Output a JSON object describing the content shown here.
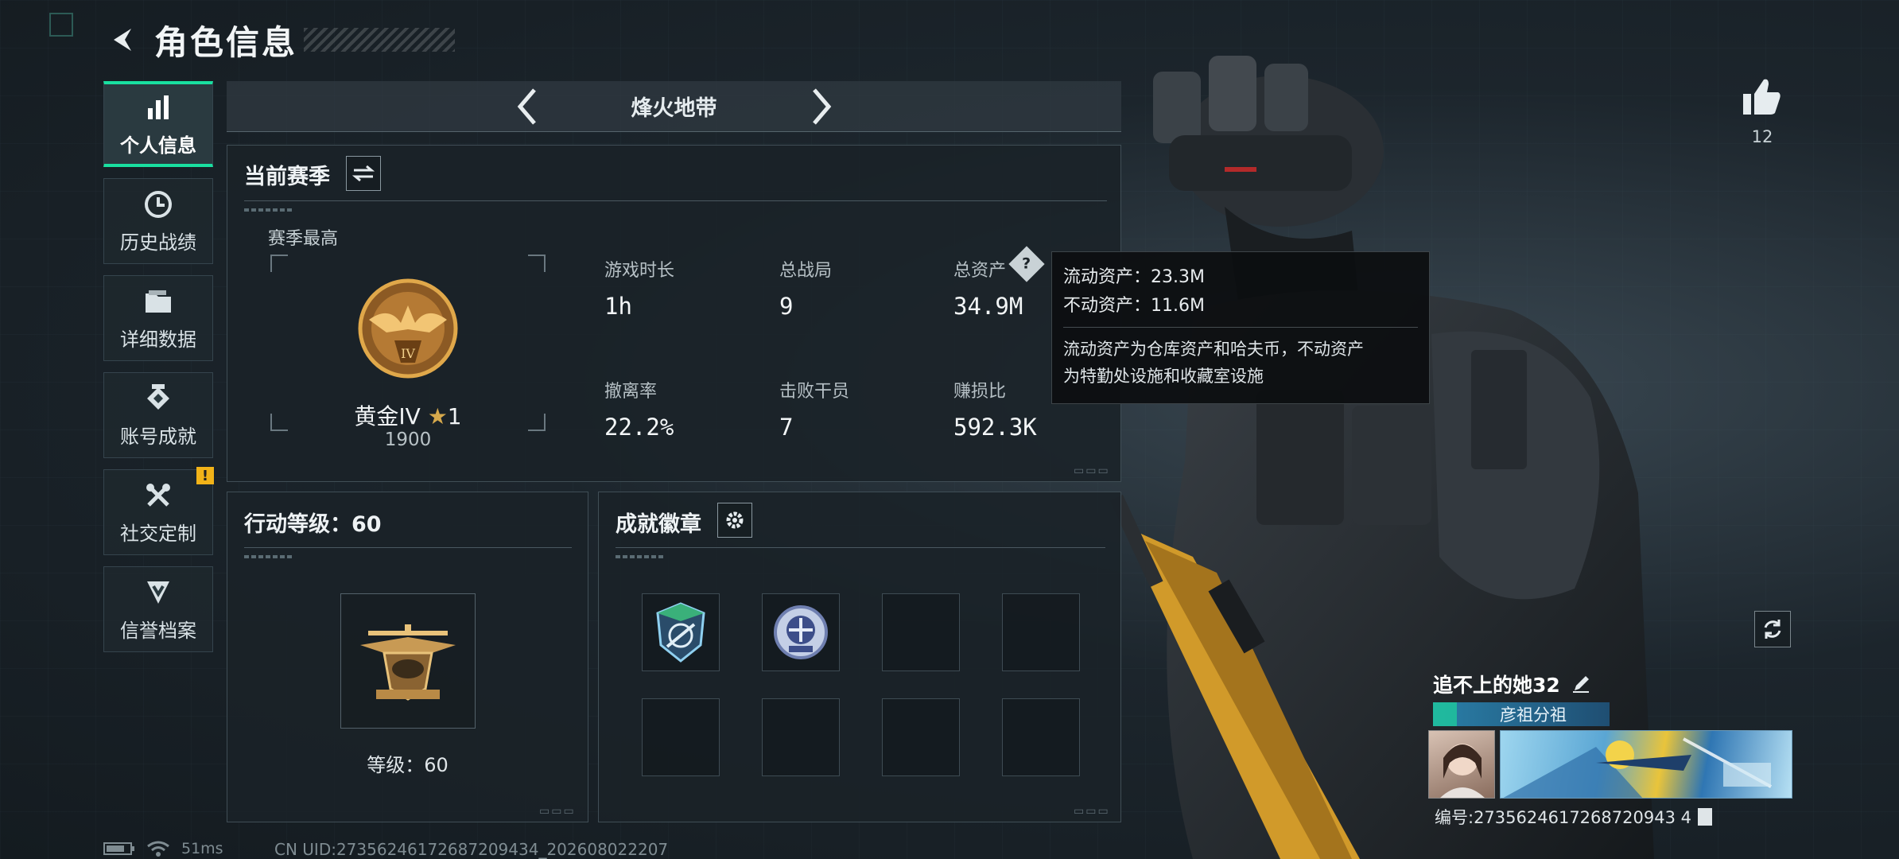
{
  "header": {
    "title": "角色信息"
  },
  "sidebar": {
    "items": [
      {
        "label": "个人信息",
        "icon": "bar-chart-icon",
        "active": true
      },
      {
        "label": "历史战绩",
        "icon": "history-clock-icon"
      },
      {
        "label": "详细数据",
        "icon": "folder-icon"
      },
      {
        "label": "账号成就",
        "icon": "achievement-emblem-icon"
      },
      {
        "label": "社交定制",
        "icon": "tools-icon",
        "badge": "!"
      },
      {
        "label": "信誉档案",
        "icon": "shield-chevron-icon"
      }
    ]
  },
  "mode_selector": {
    "title": "烽火地带"
  },
  "current_season": {
    "title": "当前赛季",
    "season_best_label": "赛季最高",
    "rank_name": "黄金IV",
    "rank_stars": "1",
    "rank_score": "1900",
    "rank_numeral": "IV",
    "stats": [
      {
        "label": "游戏时长",
        "value": "1h"
      },
      {
        "label": "总战局",
        "value": "9"
      },
      {
        "label": "总资产",
        "value": "34.9M"
      },
      {
        "label": "撤离率",
        "value": "22.2%"
      },
      {
        "label": "击败干员",
        "value": "7"
      },
      {
        "label": "赚损比",
        "value": "592.3K"
      }
    ]
  },
  "tooltip": {
    "liquid_assets": "流动资产：23.3M",
    "fixed_assets": "不动资产：11.6M",
    "desc_line1": "流动资产为仓库资产和哈夫币，不动资产",
    "desc_line2": "为特勤处设施和收藏室设施"
  },
  "action_level": {
    "title": "行动等级：60",
    "level_label": "等级：60"
  },
  "achievements": {
    "title": "成就徽章"
  },
  "like": {
    "count": "12"
  },
  "player": {
    "name": "追不上的她32",
    "team": "彦祖分祖",
    "id": "编号:2735624617268720943 4"
  },
  "status": {
    "ping": "51ms",
    "uid": "CN UID:27356246172687209434_202608022207"
  },
  "colors": {
    "accent_green": "#19e0a0",
    "warning": "#f2b318",
    "gold": "#c8923b"
  }
}
